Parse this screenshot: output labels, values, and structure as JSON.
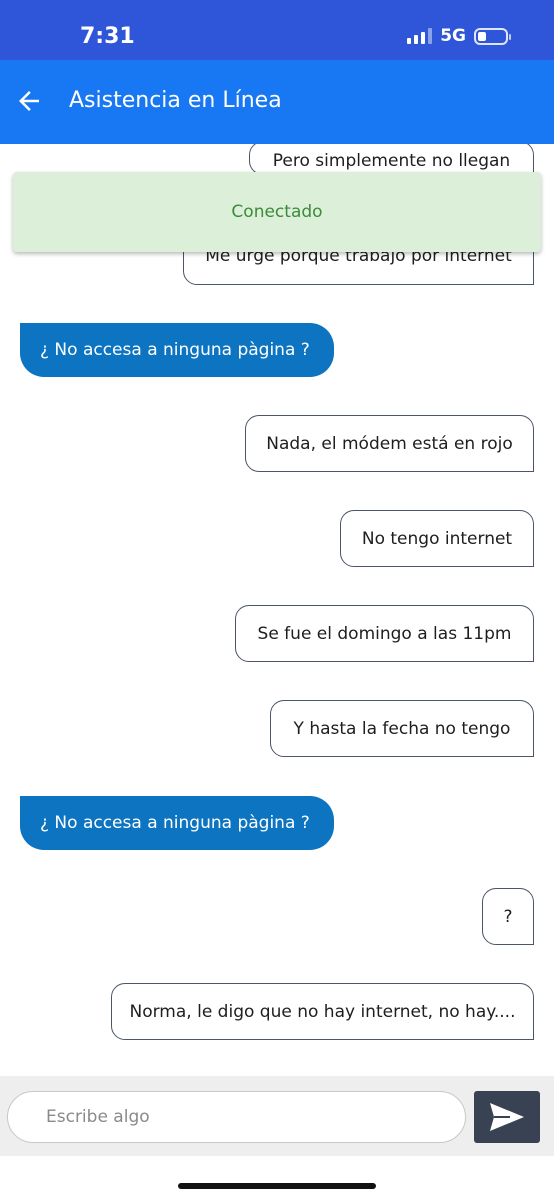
{
  "status_bar": {
    "time": "7:31",
    "network": "5G"
  },
  "header": {
    "title": "Asistencia en Línea"
  },
  "toast": {
    "text": "Conectado"
  },
  "messages": [
    {
      "from": "user",
      "text": "Pero simplemente no llegan"
    },
    {
      "from": "user",
      "text": "Me urge porque trabajo por internet"
    },
    {
      "from": "agent",
      "text": "¿ No accesa a ninguna pàgina ?"
    },
    {
      "from": "user",
      "text": "Nada, el módem está en rojo"
    },
    {
      "from": "user",
      "text": "No tengo internet"
    },
    {
      "from": "user",
      "text": "Se fue el domingo a las 11pm"
    },
    {
      "from": "user",
      "text": "Y hasta la fecha no tengo"
    },
    {
      "from": "agent",
      "text": "¿ No accesa a ninguna pàgina ?"
    },
    {
      "from": "user",
      "text": "?"
    },
    {
      "from": "user",
      "text": "Norma, le digo que no hay internet, no hay...."
    }
  ],
  "composer": {
    "placeholder": "Escribe algo"
  },
  "colors": {
    "status_bar": "#2f55d8",
    "app_bar": "#1877f2",
    "agent_bubble": "#0c74c0",
    "toast_bg": "#dcefd8",
    "toast_text": "#3c8a3c",
    "send_button": "#384252"
  },
  "icons": {
    "back": "arrow-left-icon",
    "send": "send-icon"
  }
}
